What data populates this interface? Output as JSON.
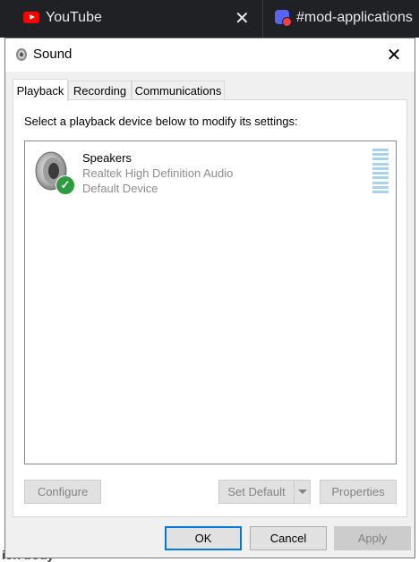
{
  "browser": {
    "tabs": [
      {
        "title": "YouTube"
      },
      {
        "title": "#mod-applications"
      }
    ],
    "background_text": "ion body"
  },
  "dialog": {
    "title": "Sound",
    "tabs": [
      {
        "label": "Playback",
        "active": true
      },
      {
        "label": "Recording",
        "active": false
      },
      {
        "label": "Communications",
        "active": false
      }
    ],
    "instruction": "Select a playback device below to modify its settings:",
    "devices": [
      {
        "name": "Speakers",
        "driver": "Realtek High Definition Audio",
        "status": "Default Device",
        "icon": "speaker-icon",
        "is_default": true
      }
    ],
    "buttons": {
      "configure": "Configure",
      "set_default": "Set Default",
      "properties": "Properties",
      "ok": "OK",
      "cancel": "Cancel",
      "apply": "Apply"
    },
    "colors": {
      "accent": "#0078d7",
      "default_check": "#2e9b3e",
      "level_meter": "#a9d3ea"
    }
  }
}
